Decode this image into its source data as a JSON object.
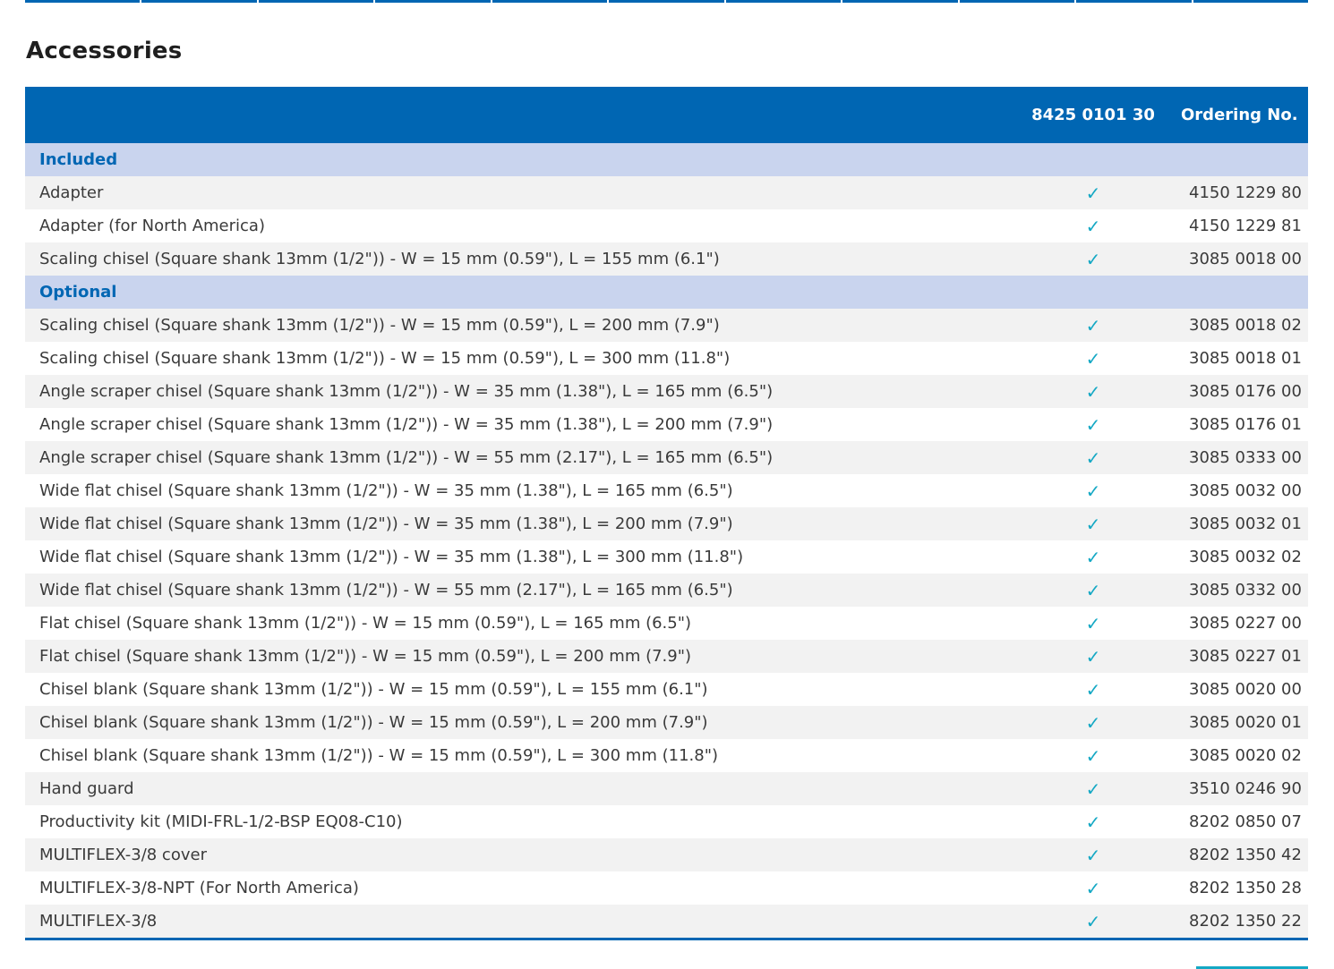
{
  "section_title": "Accessories",
  "table": {
    "columns": [
      "",
      "8425 0101 30",
      "Ordering No."
    ],
    "groups": [
      {
        "name": "Included",
        "rows": [
          {
            "description": "Adapter",
            "check": "✓",
            "ordering_no": "4150 1229 80"
          },
          {
            "description": "Adapter (for North America)",
            "check": "✓",
            "ordering_no": "4150 1229 81"
          },
          {
            "description": "Scaling chisel (Square shank 13mm (1/2\")) - W = 15 mm (0.59\"), L = 155 mm (6.1\")",
            "check": "✓",
            "ordering_no": "3085 0018 00"
          }
        ]
      },
      {
        "name": "Optional",
        "rows": [
          {
            "description": "Scaling chisel (Square shank 13mm (1/2\")) - W = 15 mm (0.59\"), L = 200 mm (7.9\")",
            "check": "✓",
            "ordering_no": "3085 0018 02"
          },
          {
            "description": "Scaling chisel (Square shank 13mm (1/2\")) - W = 15 mm (0.59\"), L = 300 mm (11.8\")",
            "check": "✓",
            "ordering_no": "3085 0018 01"
          },
          {
            "description": "Angle scraper chisel (Square shank 13mm (1/2\")) - W = 35 mm (1.38\"), L = 165 mm (6.5\")",
            "check": "✓",
            "ordering_no": "3085 0176 00"
          },
          {
            "description": "Angle scraper chisel (Square shank 13mm (1/2\")) - W = 35 mm (1.38\"), L = 200 mm (7.9\")",
            "check": "✓",
            "ordering_no": "3085 0176 01"
          },
          {
            "description": "Angle scraper chisel (Square shank 13mm (1/2\")) - W = 55 mm (2.17\"), L = 165 mm (6.5\")",
            "check": "✓",
            "ordering_no": "3085 0333 00"
          },
          {
            "description": "Wide flat chisel (Square shank 13mm (1/2\")) - W = 35 mm (1.38\"), L = 165 mm (6.5\")",
            "check": "✓",
            "ordering_no": "3085 0032 00"
          },
          {
            "description": "Wide flat chisel (Square shank 13mm (1/2\")) - W = 35 mm (1.38\"), L = 200 mm (7.9\")",
            "check": "✓",
            "ordering_no": "3085 0032 01"
          },
          {
            "description": "Wide flat chisel (Square shank 13mm (1/2\")) - W = 35 mm (1.38\"), L = 300 mm (11.8\")",
            "check": "✓",
            "ordering_no": "3085 0032 02"
          },
          {
            "description": "Wide flat chisel (Square shank 13mm (1/2\")) - W = 55 mm (2.17\"), L = 165 mm (6.5\")",
            "check": "✓",
            "ordering_no": "3085 0332 00"
          },
          {
            "description": "Flat chisel (Square shank 13mm (1/2\")) - W = 15 mm (0.59\"), L = 165 mm (6.5\")",
            "check": "✓",
            "ordering_no": "3085 0227 00"
          },
          {
            "description": "Flat chisel (Square shank 13mm (1/2\")) - W = 15 mm (0.59\"), L = 200 mm (7.9\")",
            "check": "✓",
            "ordering_no": "3085 0227 01"
          },
          {
            "description": "Chisel blank (Square shank 13mm (1/2\")) - W = 15 mm (0.59\"), L = 155 mm (6.1\")",
            "check": "✓",
            "ordering_no": "3085 0020 00"
          },
          {
            "description": "Chisel blank (Square shank 13mm (1/2\")) - W = 15 mm (0.59\"), L = 200 mm (7.9\")",
            "check": "✓",
            "ordering_no": "3085 0020 01"
          },
          {
            "description": "Chisel blank (Square shank 13mm (1/2\")) - W = 15 mm (0.59\"), L = 300 mm (11.8\")",
            "check": "✓",
            "ordering_no": "3085 0020 02"
          },
          {
            "description": "Hand guard",
            "check": "✓",
            "ordering_no": "3510 0246 90"
          },
          {
            "description": "Productivity kit (MIDI-FRL-1/2-BSP EQ08-C10)",
            "check": "✓",
            "ordering_no": "8202 0850 07"
          },
          {
            "description": "MULTIFLEX-3/8 cover",
            "check": "✓",
            "ordering_no": "8202 1350 42"
          },
          {
            "description": "MULTIFLEX-3/8-NPT (For North America)",
            "check": "✓",
            "ordering_no": "8202 1350 28"
          },
          {
            "description": "MULTIFLEX-3/8",
            "check": "✓",
            "ordering_no": "8202 1350 22"
          }
        ]
      }
    ]
  },
  "colors": {
    "header_blue": "#0066b3",
    "group_band": "#c9d4ee",
    "check_teal": "#14a8c4",
    "row_alt": "#f2f2f2"
  }
}
